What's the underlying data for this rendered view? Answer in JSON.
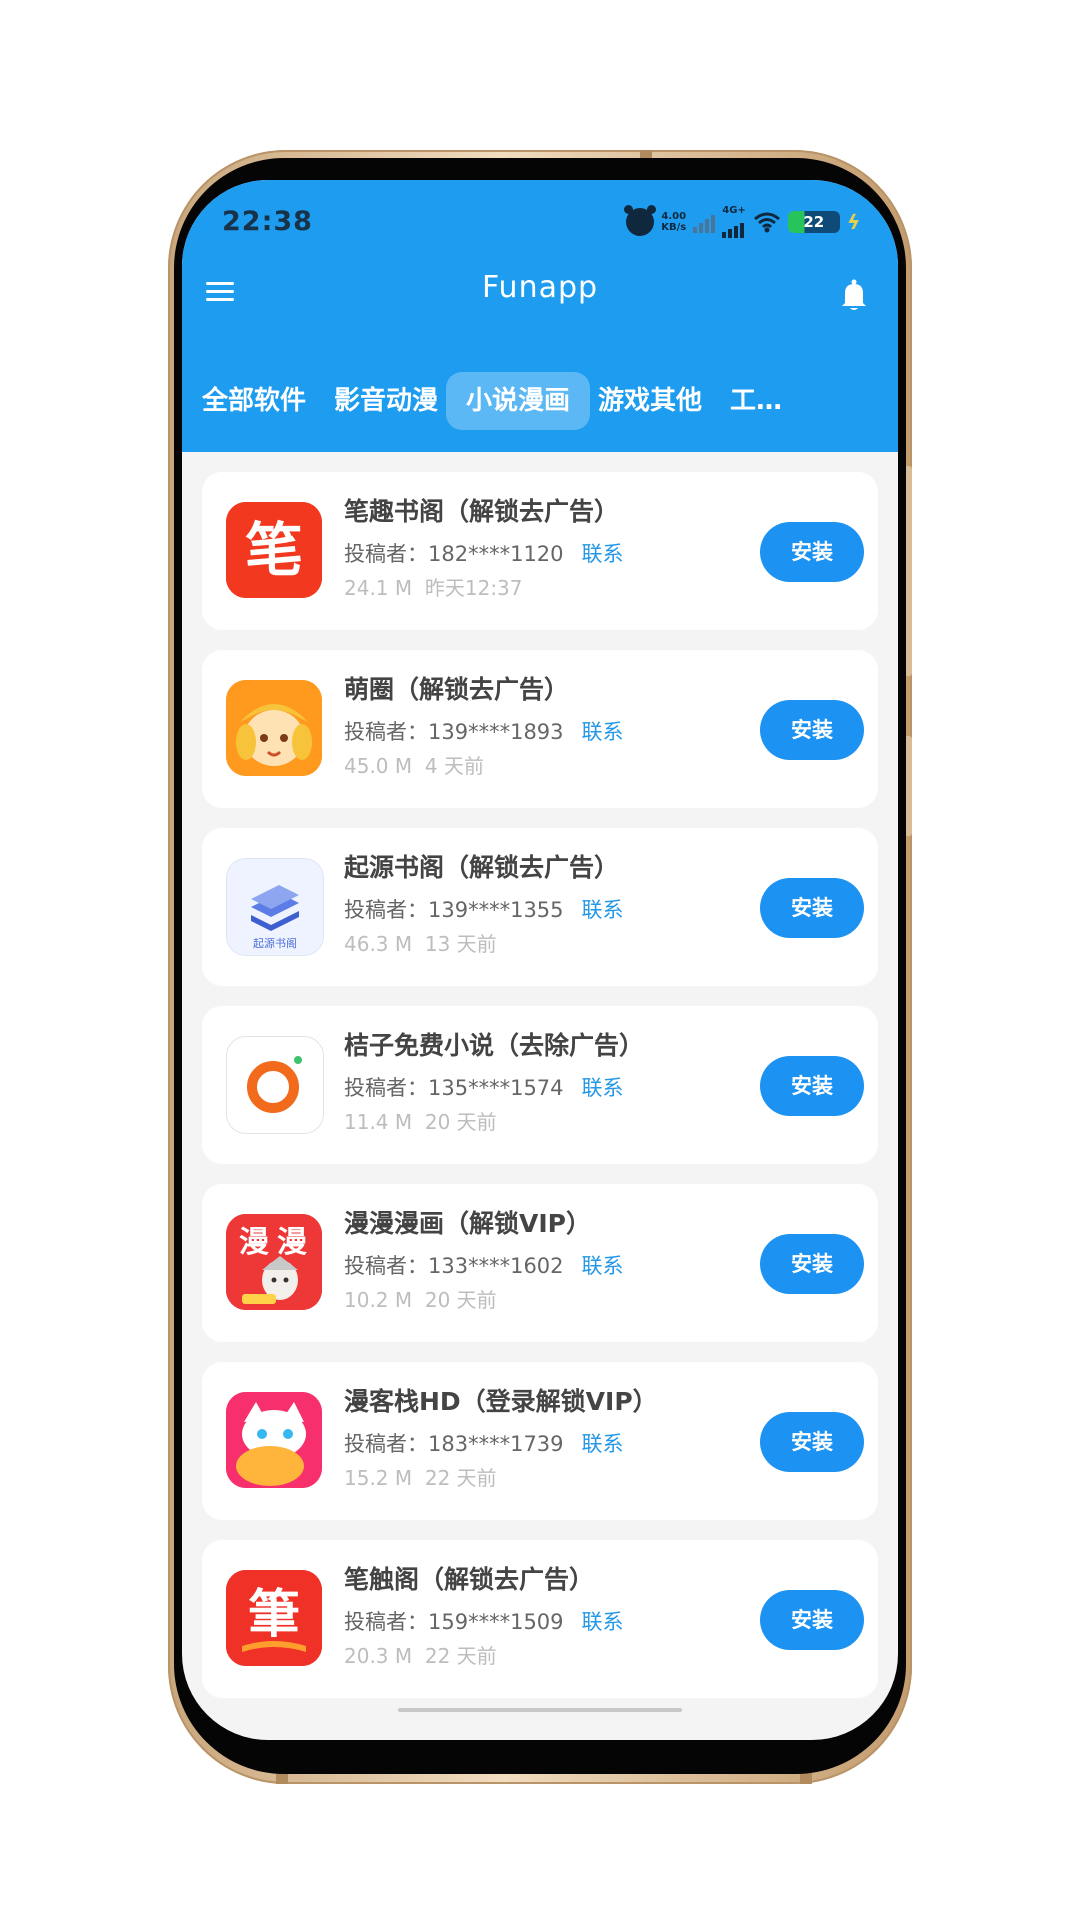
{
  "status_bar": {
    "time": "22:38",
    "net_speed_value": "4.00",
    "net_speed_unit": "KB/s",
    "network_type": "4G+",
    "battery": "22",
    "icons": [
      "alarm-icon",
      "signal-weak-icon",
      "signal-4g-icon",
      "wifi-icon",
      "battery-icon",
      "charging-bolt-icon"
    ]
  },
  "header": {
    "title": "Funapp",
    "menu_icon": "hamburger-menu-icon",
    "bell_icon": "bell-icon"
  },
  "tabs": [
    {
      "label": "全部软件",
      "active": false
    },
    {
      "label": "影音动漫",
      "active": false
    },
    {
      "label": "小说漫画",
      "active": true
    },
    {
      "label": "游戏其他",
      "active": false
    },
    {
      "label": "工…",
      "active": false
    }
  ],
  "apps": [
    {
      "name": "笔趣书阁（解锁去广告）",
      "submitter_label": "投稿者：",
      "submitter": "182****1120",
      "contact": "联系",
      "size": "24.1 M",
      "time": "昨天12:37",
      "install": "安装",
      "icon": "笔",
      "icon_color": "#f2391f"
    },
    {
      "name": "萌圈（解锁去广告）",
      "submitter_label": "投稿者：",
      "submitter": "139****1893",
      "contact": "联系",
      "size": "45.0 M",
      "time": "4 天前",
      "install": "安装",
      "icon": "anime-face",
      "icon_color": "#ff9a1f"
    },
    {
      "name": "起源书阁（解锁去广告）",
      "submitter_label": "投稿者：",
      "submitter": "139****1355",
      "contact": "联系",
      "size": "46.3 M",
      "time": "13 天前",
      "install": "安装",
      "icon": "起源书阁",
      "icon_color": "#4f6fd8"
    },
    {
      "name": "桔子免费小说（去除广告）",
      "submitter_label": "投稿者：",
      "submitter": "135****1574",
      "contact": "联系",
      "size": "11.4 M",
      "time": "20 天前",
      "install": "安装",
      "icon": "orange-ring",
      "icon_color": "#f26a1b"
    },
    {
      "name": "漫漫漫画（解锁VIP）",
      "submitter_label": "投稿者：",
      "submitter": "133****1602",
      "contact": "联系",
      "size": "10.2 M",
      "time": "20 天前",
      "install": "安装",
      "icon": "漫漫",
      "icon_color": "#ee3737"
    },
    {
      "name": "漫客栈HD（登录解锁VIP）",
      "submitter_label": "投稿者：",
      "submitter": "183****1739",
      "contact": "联系",
      "size": "15.2 M",
      "time": "22 天前",
      "install": "安装",
      "icon": "HD",
      "icon_color": "#f7306d"
    },
    {
      "name": "笔触阁（解锁去广告）",
      "submitter_label": "投稿者：",
      "submitter": "159****1509",
      "contact": "联系",
      "size": "20.3 M",
      "time": "22 天前",
      "install": "安装",
      "icon": "筆",
      "icon_color": "#f03127"
    }
  ]
}
